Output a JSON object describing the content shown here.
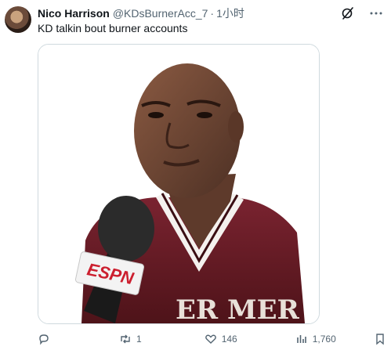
{
  "tweet": {
    "author_name": "Nico Harrison",
    "handle": "@KDsBurnerAcc_7",
    "separator": "·",
    "time": "1小时",
    "text": "KD talkin bout burner accounts",
    "media": {
      "logo_text": "ESPN",
      "jersey_text": "ER  MER"
    },
    "stats": {
      "replies": "",
      "retweets": "1",
      "likes": "146",
      "views": "1,760"
    }
  },
  "icons": {
    "grok": "grok-icon",
    "more": "more-icon",
    "reply": "reply-icon",
    "retweet": "retweet-icon",
    "like": "heart-icon",
    "views": "views-icon",
    "bookmark": "bookmark-icon",
    "share": "share-icon"
  },
  "colors": {
    "text": "#0f1419",
    "muted": "#536471",
    "border": "#cfd9de",
    "jersey": "#6e1b24"
  }
}
